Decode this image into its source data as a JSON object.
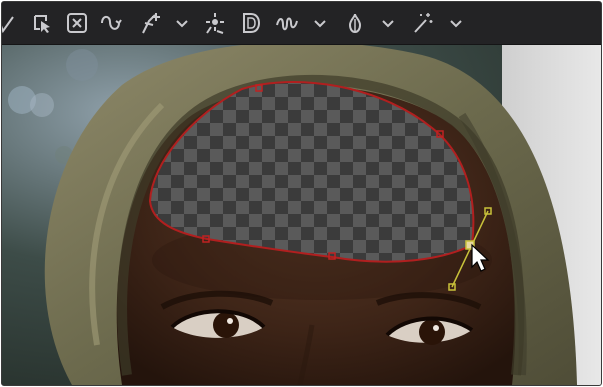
{
  "app": {
    "accent_color": "#c0c0c4",
    "mask_color": "#b11f1f",
    "handle_color": "#c9c23a"
  },
  "toolbar": {
    "tools": [
      {
        "name": "polyline-tool-partial",
        "icon": "polyline-icon"
      },
      {
        "name": "select-mask-tool",
        "icon": "select-mask-icon"
      },
      {
        "name": "delete-points-tool",
        "icon": "delete-points-icon"
      },
      {
        "name": "smooth-curve-tool",
        "icon": "smooth-curve-icon"
      },
      {
        "name": "add-point-tool",
        "icon": "add-point-icon"
      },
      {
        "name": "add-point-dropdown",
        "icon": "chevron-down-icon"
      },
      {
        "name": "tracker-point-tool",
        "icon": "tracker-point-icon"
      },
      {
        "name": "draw-mode-tool",
        "icon": "draw-mode-icon"
      },
      {
        "name": "freehand-tool",
        "icon": "freehand-icon"
      },
      {
        "name": "freehand-dropdown",
        "icon": "chevron-down-icon"
      },
      {
        "name": "onion-tool",
        "icon": "onion-icon"
      },
      {
        "name": "onion-dropdown",
        "icon": "chevron-down-icon"
      },
      {
        "name": "magic-wand-tool",
        "icon": "magic-wand-icon"
      },
      {
        "name": "magic-wand-dropdown",
        "icon": "chevron-down-icon"
      }
    ]
  },
  "viewer": {
    "content": "hooded-person-forehead-mask",
    "transparency_pattern": "checkerboard"
  }
}
